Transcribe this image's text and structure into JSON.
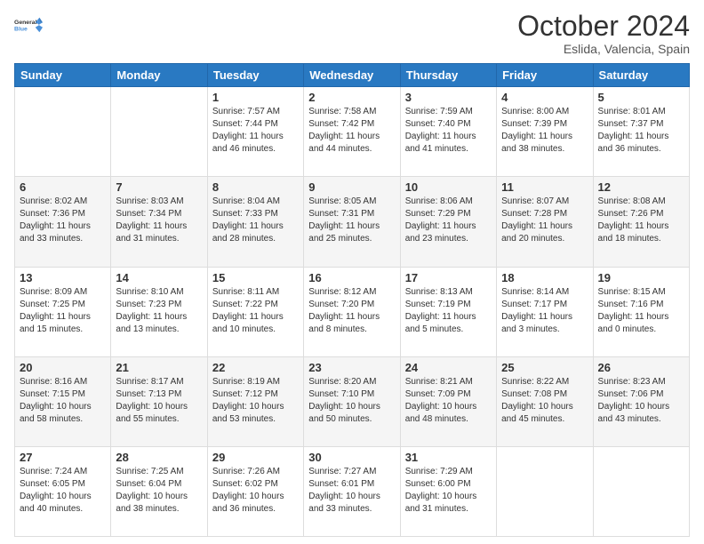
{
  "header": {
    "logo_line1": "General",
    "logo_line2": "Blue",
    "month": "October 2024",
    "location": "Eslida, Valencia, Spain"
  },
  "days_of_week": [
    "Sunday",
    "Monday",
    "Tuesday",
    "Wednesday",
    "Thursday",
    "Friday",
    "Saturday"
  ],
  "weeks": [
    [
      {
        "day": "",
        "info": ""
      },
      {
        "day": "",
        "info": ""
      },
      {
        "day": "1",
        "info": "Sunrise: 7:57 AM\nSunset: 7:44 PM\nDaylight: 11 hours and 46 minutes."
      },
      {
        "day": "2",
        "info": "Sunrise: 7:58 AM\nSunset: 7:42 PM\nDaylight: 11 hours and 44 minutes."
      },
      {
        "day": "3",
        "info": "Sunrise: 7:59 AM\nSunset: 7:40 PM\nDaylight: 11 hours and 41 minutes."
      },
      {
        "day": "4",
        "info": "Sunrise: 8:00 AM\nSunset: 7:39 PM\nDaylight: 11 hours and 38 minutes."
      },
      {
        "day": "5",
        "info": "Sunrise: 8:01 AM\nSunset: 7:37 PM\nDaylight: 11 hours and 36 minutes."
      }
    ],
    [
      {
        "day": "6",
        "info": "Sunrise: 8:02 AM\nSunset: 7:36 PM\nDaylight: 11 hours and 33 minutes."
      },
      {
        "day": "7",
        "info": "Sunrise: 8:03 AM\nSunset: 7:34 PM\nDaylight: 11 hours and 31 minutes."
      },
      {
        "day": "8",
        "info": "Sunrise: 8:04 AM\nSunset: 7:33 PM\nDaylight: 11 hours and 28 minutes."
      },
      {
        "day": "9",
        "info": "Sunrise: 8:05 AM\nSunset: 7:31 PM\nDaylight: 11 hours and 25 minutes."
      },
      {
        "day": "10",
        "info": "Sunrise: 8:06 AM\nSunset: 7:29 PM\nDaylight: 11 hours and 23 minutes."
      },
      {
        "day": "11",
        "info": "Sunrise: 8:07 AM\nSunset: 7:28 PM\nDaylight: 11 hours and 20 minutes."
      },
      {
        "day": "12",
        "info": "Sunrise: 8:08 AM\nSunset: 7:26 PM\nDaylight: 11 hours and 18 minutes."
      }
    ],
    [
      {
        "day": "13",
        "info": "Sunrise: 8:09 AM\nSunset: 7:25 PM\nDaylight: 11 hours and 15 minutes."
      },
      {
        "day": "14",
        "info": "Sunrise: 8:10 AM\nSunset: 7:23 PM\nDaylight: 11 hours and 13 minutes."
      },
      {
        "day": "15",
        "info": "Sunrise: 8:11 AM\nSunset: 7:22 PM\nDaylight: 11 hours and 10 minutes."
      },
      {
        "day": "16",
        "info": "Sunrise: 8:12 AM\nSunset: 7:20 PM\nDaylight: 11 hours and 8 minutes."
      },
      {
        "day": "17",
        "info": "Sunrise: 8:13 AM\nSunset: 7:19 PM\nDaylight: 11 hours and 5 minutes."
      },
      {
        "day": "18",
        "info": "Sunrise: 8:14 AM\nSunset: 7:17 PM\nDaylight: 11 hours and 3 minutes."
      },
      {
        "day": "19",
        "info": "Sunrise: 8:15 AM\nSunset: 7:16 PM\nDaylight: 11 hours and 0 minutes."
      }
    ],
    [
      {
        "day": "20",
        "info": "Sunrise: 8:16 AM\nSunset: 7:15 PM\nDaylight: 10 hours and 58 minutes."
      },
      {
        "day": "21",
        "info": "Sunrise: 8:17 AM\nSunset: 7:13 PM\nDaylight: 10 hours and 55 minutes."
      },
      {
        "day": "22",
        "info": "Sunrise: 8:19 AM\nSunset: 7:12 PM\nDaylight: 10 hours and 53 minutes."
      },
      {
        "day": "23",
        "info": "Sunrise: 8:20 AM\nSunset: 7:10 PM\nDaylight: 10 hours and 50 minutes."
      },
      {
        "day": "24",
        "info": "Sunrise: 8:21 AM\nSunset: 7:09 PM\nDaylight: 10 hours and 48 minutes."
      },
      {
        "day": "25",
        "info": "Sunrise: 8:22 AM\nSunset: 7:08 PM\nDaylight: 10 hours and 45 minutes."
      },
      {
        "day": "26",
        "info": "Sunrise: 8:23 AM\nSunset: 7:06 PM\nDaylight: 10 hours and 43 minutes."
      }
    ],
    [
      {
        "day": "27",
        "info": "Sunrise: 7:24 AM\nSunset: 6:05 PM\nDaylight: 10 hours and 40 minutes."
      },
      {
        "day": "28",
        "info": "Sunrise: 7:25 AM\nSunset: 6:04 PM\nDaylight: 10 hours and 38 minutes."
      },
      {
        "day": "29",
        "info": "Sunrise: 7:26 AM\nSunset: 6:02 PM\nDaylight: 10 hours and 36 minutes."
      },
      {
        "day": "30",
        "info": "Sunrise: 7:27 AM\nSunset: 6:01 PM\nDaylight: 10 hours and 33 minutes."
      },
      {
        "day": "31",
        "info": "Sunrise: 7:29 AM\nSunset: 6:00 PM\nDaylight: 10 hours and 31 minutes."
      },
      {
        "day": "",
        "info": ""
      },
      {
        "day": "",
        "info": ""
      }
    ]
  ]
}
